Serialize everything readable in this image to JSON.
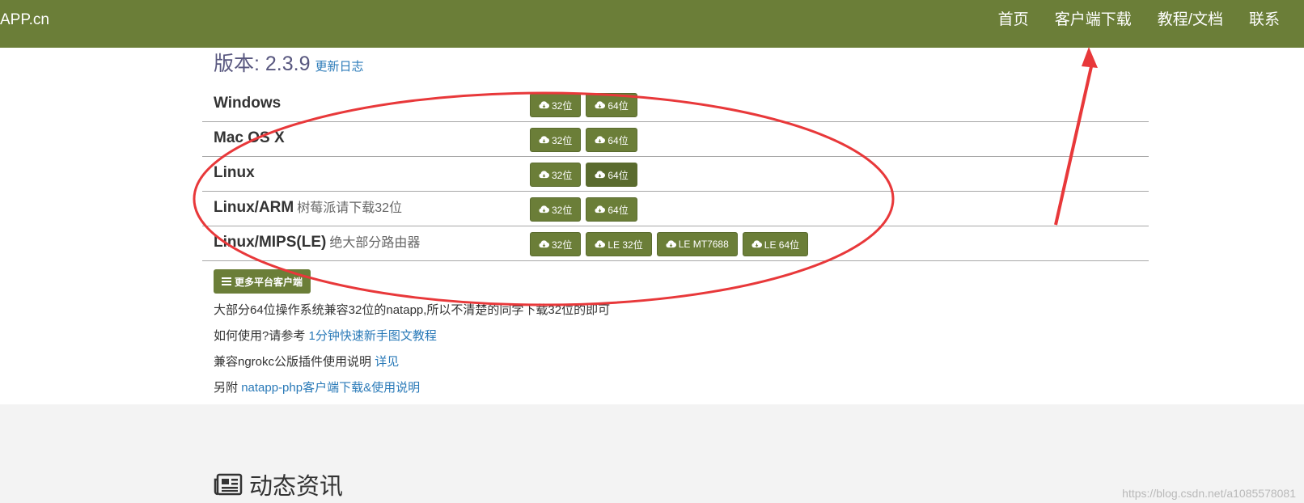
{
  "navbar": {
    "brand": "APP.cn",
    "links": [
      "首页",
      "客户端下载",
      "教程/文档",
      "联系"
    ]
  },
  "version": {
    "label": "版本: 2.3.9",
    "changelog": "更新日志"
  },
  "platforms": [
    {
      "name": "Windows",
      "note": "",
      "buttons": [
        "32位",
        "64位"
      ]
    },
    {
      "name": "Mac OS X",
      "note": "",
      "buttons": [
        "32位",
        "64位"
      ]
    },
    {
      "name": "Linux",
      "note": "",
      "buttons": [
        "32位",
        "64位"
      ]
    },
    {
      "name": "Linux/ARM",
      "note": "树莓派请下载32位",
      "buttons": [
        "32位",
        "64位"
      ]
    },
    {
      "name": "Linux/MIPS(LE)",
      "note": "绝大部分路由器",
      "buttons": [
        "32位",
        "LE 32位",
        "LE MT7688",
        "LE 64位"
      ]
    }
  ],
  "more_button": "更多平台客户端",
  "info": {
    "line1": "大部分64位操作系统兼容32位的natapp,所以不清楚的同学下载32位的即可",
    "line2_prefix": "如何使用?请参考",
    "line2_link": "1分钟快速新手图文教程",
    "line3_prefix": "兼容ngrokc公版插件使用说明",
    "line3_link": "详见",
    "line4_prefix": "另附",
    "line4_link": "natapp-php客户端下载&使用说明"
  },
  "news": {
    "title": "动态资讯"
  },
  "watermark": "https://blog.csdn.net/a1085578081",
  "colors": {
    "navbar": "#6b7e38",
    "button": "#6b7e38",
    "link": "#2a7ab8",
    "annotation": "#e8383a"
  }
}
